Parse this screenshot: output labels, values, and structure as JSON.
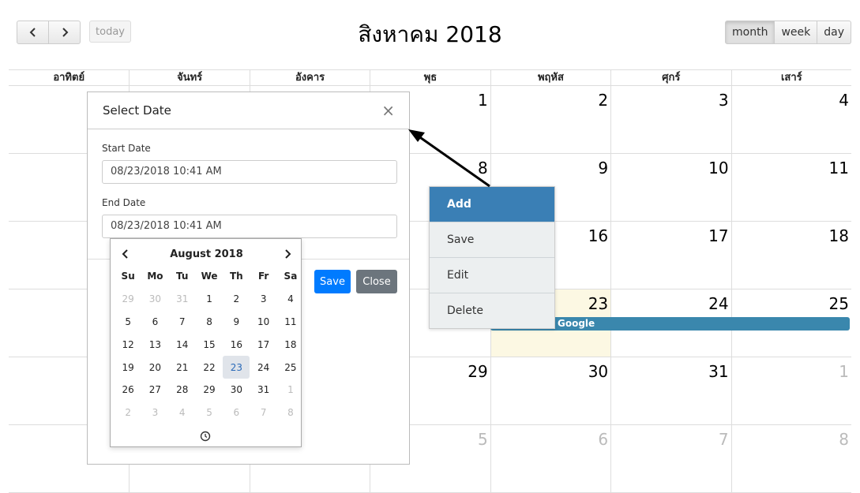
{
  "toolbar": {
    "prev_icon": "chevron-left-icon",
    "next_icon": "chevron-right-icon",
    "today_label": "today",
    "title": "สิงหาคม 2018",
    "views": [
      "month",
      "week",
      "day"
    ],
    "active_view": "month"
  },
  "calendar": {
    "weekdays": [
      "อาทิตย์",
      "จันทร์",
      "อังคาร",
      "พุธ",
      "พฤหัส",
      "ศุกร์",
      "เสาร์"
    ],
    "weeks": [
      [
        {
          "d": "",
          "o": false
        },
        {
          "d": "",
          "o": false
        },
        {
          "d": "",
          "o": false
        },
        {
          "d": "1",
          "o": false
        },
        {
          "d": "2",
          "o": false
        },
        {
          "d": "3",
          "o": false
        },
        {
          "d": "4",
          "o": false
        }
      ],
      [
        {
          "d": "",
          "o": false
        },
        {
          "d": "",
          "o": false
        },
        {
          "d": "",
          "o": false
        },
        {
          "d": "8",
          "o": false
        },
        {
          "d": "9",
          "o": false
        },
        {
          "d": "10",
          "o": false
        },
        {
          "d": "11",
          "o": false
        }
      ],
      [
        {
          "d": "",
          "o": false
        },
        {
          "d": "",
          "o": false
        },
        {
          "d": "",
          "o": false
        },
        {
          "d": "",
          "o": false
        },
        {
          "d": "16",
          "o": false
        },
        {
          "d": "17",
          "o": false
        },
        {
          "d": "18",
          "o": false
        }
      ],
      [
        {
          "d": "",
          "o": false
        },
        {
          "d": "",
          "o": false
        },
        {
          "d": "",
          "o": false
        },
        {
          "d": "",
          "o": false
        },
        {
          "d": "23",
          "o": false,
          "today": true
        },
        {
          "d": "24",
          "o": false
        },
        {
          "d": "25",
          "o": false
        }
      ],
      [
        {
          "d": "",
          "o": false
        },
        {
          "d": "",
          "o": false
        },
        {
          "d": "",
          "o": false
        },
        {
          "d": "29",
          "o": false
        },
        {
          "d": "30",
          "o": false
        },
        {
          "d": "31",
          "o": false
        },
        {
          "d": "1",
          "o": true
        }
      ],
      [
        {
          "d": "",
          "o": false
        },
        {
          "d": "",
          "o": false
        },
        {
          "d": "",
          "o": false
        },
        {
          "d": "5",
          "o": true
        },
        {
          "d": "6",
          "o": true
        },
        {
          "d": "7",
          "o": true
        },
        {
          "d": "8",
          "o": true
        }
      ]
    ],
    "event_label": "Google",
    "event_color": "#3a87ad",
    "today_color": "#fcf8e3"
  },
  "modal": {
    "title": "Select Date",
    "close_icon": "close-icon",
    "start_label": "Start Date",
    "start_value": "08/23/2018 10:41 AM",
    "end_label": "End Date",
    "end_value": "08/23/2018 10:41 AM",
    "save_label": "Save",
    "close_label": "Close"
  },
  "datepicker": {
    "month_label": "August 2018",
    "weekdays": [
      "Su",
      "Mo",
      "Tu",
      "We",
      "Th",
      "Fr",
      "Sa"
    ],
    "days": [
      [
        "29",
        "m"
      ],
      [
        "30",
        "m"
      ],
      [
        "31",
        "m"
      ],
      [
        "1",
        ""
      ],
      [
        "2",
        ""
      ],
      [
        "3",
        ""
      ],
      [
        "4",
        ""
      ],
      [
        "5",
        ""
      ],
      [
        "6",
        ""
      ],
      [
        "7",
        ""
      ],
      [
        "8",
        ""
      ],
      [
        "9",
        ""
      ],
      [
        "10",
        ""
      ],
      [
        "11",
        ""
      ],
      [
        "12",
        ""
      ],
      [
        "13",
        ""
      ],
      [
        "14",
        ""
      ],
      [
        "15",
        ""
      ],
      [
        "16",
        ""
      ],
      [
        "17",
        ""
      ],
      [
        "18",
        ""
      ],
      [
        "19",
        ""
      ],
      [
        "20",
        ""
      ],
      [
        "21",
        ""
      ],
      [
        "22",
        ""
      ],
      [
        "23",
        "s"
      ],
      [
        "24",
        ""
      ],
      [
        "25",
        ""
      ],
      [
        "26",
        ""
      ],
      [
        "27",
        ""
      ],
      [
        "28",
        ""
      ],
      [
        "29",
        ""
      ],
      [
        "30",
        ""
      ],
      [
        "31",
        ""
      ],
      [
        "1",
        "m"
      ],
      [
        "2",
        "m"
      ],
      [
        "3",
        "m"
      ],
      [
        "4",
        "m"
      ],
      [
        "5",
        "m"
      ],
      [
        "6",
        "m"
      ],
      [
        "7",
        "m"
      ],
      [
        "8",
        "m"
      ]
    ],
    "selected_day": "23",
    "clock_icon": "clock-icon"
  },
  "context_menu": {
    "items": [
      {
        "label": "Add",
        "active": true
      },
      {
        "label": "Save",
        "active": false
      },
      {
        "label": "Edit",
        "active": false
      },
      {
        "label": "Delete",
        "active": false
      }
    ]
  }
}
